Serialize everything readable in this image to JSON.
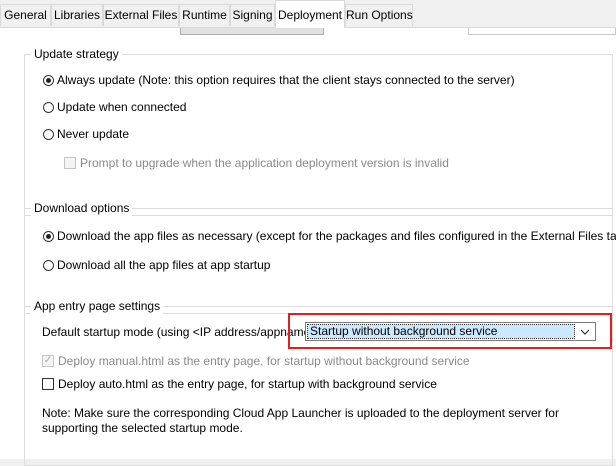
{
  "tabs": [
    {
      "label": "General"
    },
    {
      "label": "Libraries"
    },
    {
      "label": "External Files"
    },
    {
      "label": "Runtime"
    },
    {
      "label": "Signing"
    },
    {
      "label": "Deployment",
      "active": true
    },
    {
      "label": "Run Options"
    }
  ],
  "update_strategy": {
    "legend": "Update strategy",
    "options": [
      {
        "label": "Always update (Note: this option requires that the client stays connected to the server)",
        "checked": true
      },
      {
        "label": "Update when connected",
        "checked": false
      },
      {
        "label": "Never update",
        "checked": false
      }
    ],
    "prompt_checkbox": {
      "label": "Prompt to upgrade when the application deployment version is invalid",
      "checked": false,
      "enabled": false
    }
  },
  "download_options": {
    "legend": "Download options",
    "options": [
      {
        "label": "Download the app files as necessary (except for the packages and files configured in the External Files tab)",
        "checked": true
      },
      {
        "label": "Download all the app files at app startup",
        "checked": false
      }
    ]
  },
  "entry_page": {
    "legend": "App entry page settings",
    "startup_label": "Default startup mode (using <IP address/appname>):",
    "startup_value": "Startup without background service",
    "manual_checkbox": {
      "label": "Deploy manual.html as the entry page, for startup without background service",
      "checked": true,
      "enabled": false
    },
    "auto_checkbox": {
      "label": "Deploy auto.html as the entry page, for startup with background service",
      "checked": false,
      "enabled": true
    },
    "note": "Note: Make sure the corresponding Cloud App Launcher is uploaded to the deployment server for supporting the selected startup mode."
  },
  "colors": {
    "highlight": "#e02020",
    "selection": "#cce8ff"
  }
}
